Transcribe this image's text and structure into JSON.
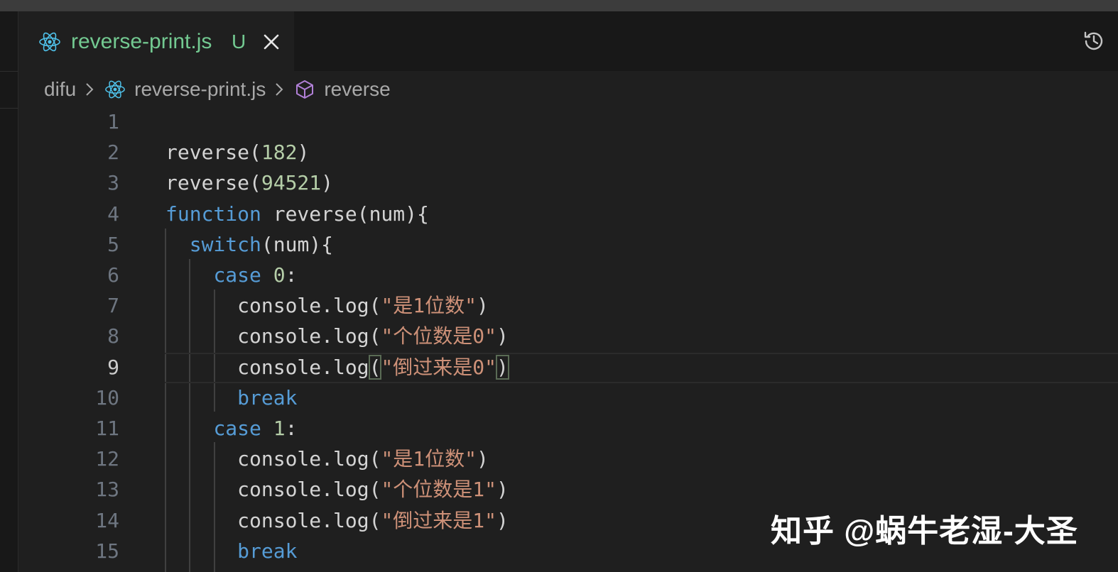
{
  "tab": {
    "filename": "reverse-print.js",
    "status": "U",
    "icon": "react-icon"
  },
  "breadcrumb": {
    "folder": "difu",
    "file": "reverse-print.js",
    "symbol": "reverse"
  },
  "colors": {
    "keyword": "#569cd6",
    "number": "#b5cea8",
    "string": "#ce9178",
    "untracked": "#73c991",
    "line_number": "#6e7681"
  },
  "current_line": 9,
  "lines": [
    {
      "n": "1",
      "tokens": []
    },
    {
      "n": "2",
      "tokens": [
        [
          "fn",
          "reverse("
        ],
        [
          "num",
          "182"
        ],
        [
          "fn",
          ")"
        ]
      ]
    },
    {
      "n": "3",
      "tokens": [
        [
          "fn",
          "reverse("
        ],
        [
          "num",
          "94521"
        ],
        [
          "fn",
          ")"
        ]
      ]
    },
    {
      "n": "4",
      "tokens": [
        [
          "kw",
          "function"
        ],
        [
          "fn",
          " reverse(num){"
        ]
      ]
    },
    {
      "n": "5",
      "tokens": [
        [
          "fn",
          "  "
        ],
        [
          "kw",
          "switch"
        ],
        [
          "fn",
          "(num){"
        ]
      ]
    },
    {
      "n": "6",
      "tokens": [
        [
          "fn",
          "    "
        ],
        [
          "kw",
          "case"
        ],
        [
          "fn",
          " "
        ],
        [
          "num",
          "0"
        ],
        [
          "fn",
          ":"
        ]
      ]
    },
    {
      "n": "7",
      "tokens": [
        [
          "fn",
          "      console.log("
        ],
        [
          "str",
          "\"是1位数\""
        ],
        [
          "fn",
          ")"
        ]
      ]
    },
    {
      "n": "8",
      "tokens": [
        [
          "fn",
          "      console.log("
        ],
        [
          "str",
          "\"个位数是0\""
        ],
        [
          "fn",
          ")"
        ]
      ]
    },
    {
      "n": "9",
      "tokens": [
        [
          "fn",
          "      console.log"
        ],
        [
          "bm",
          "("
        ],
        [
          "str",
          "\"倒过来是0\""
        ],
        [
          "bm",
          ")"
        ]
      ]
    },
    {
      "n": "10",
      "tokens": [
        [
          "fn",
          "      "
        ],
        [
          "kw",
          "break"
        ]
      ]
    },
    {
      "n": "11",
      "tokens": [
        [
          "fn",
          "    "
        ],
        [
          "kw",
          "case"
        ],
        [
          "fn",
          " "
        ],
        [
          "num",
          "1"
        ],
        [
          "fn",
          ":"
        ]
      ]
    },
    {
      "n": "12",
      "tokens": [
        [
          "fn",
          "      console.log("
        ],
        [
          "str",
          "\"是1位数\""
        ],
        [
          "fn",
          ")"
        ]
      ]
    },
    {
      "n": "13",
      "tokens": [
        [
          "fn",
          "      console.log("
        ],
        [
          "str",
          "\"个位数是1\""
        ],
        [
          "fn",
          ")"
        ]
      ]
    },
    {
      "n": "14",
      "tokens": [
        [
          "fn",
          "      console.log("
        ],
        [
          "str",
          "\"倒过来是1\""
        ],
        [
          "fn",
          ")"
        ]
      ]
    },
    {
      "n": "15",
      "tokens": [
        [
          "fn",
          "      "
        ],
        [
          "kw",
          "break"
        ]
      ]
    }
  ],
  "watermark": "知乎 @蜗牛老湿-大圣"
}
